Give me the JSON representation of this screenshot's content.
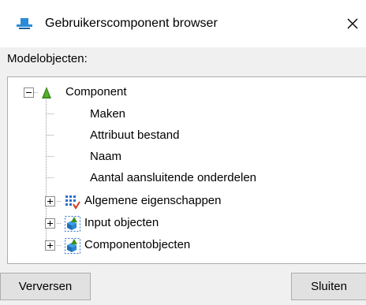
{
  "window": {
    "title": "Gebruikerscomponent browser",
    "app_icon": "tekla-logo-icon",
    "close_icon": "close-icon"
  },
  "tree_section": {
    "label": "Modelobjecten:",
    "root": {
      "label": "Component",
      "icon": "triangle-component-icon",
      "expanded": true,
      "children": [
        {
          "label": "Maken"
        },
        {
          "label": "Attribuut bestand"
        },
        {
          "label": "Naam"
        },
        {
          "label": "Aantal aansluitende onderdelen"
        },
        {
          "label": "Algemene eigenschappen",
          "icon": "properties-icon",
          "expandable": true
        },
        {
          "label": "Input objecten",
          "icon": "objects-icon",
          "expandable": true
        },
        {
          "label": "Componentobjecten",
          "icon": "objects-icon",
          "expandable": true
        }
      ]
    }
  },
  "buttons": {
    "refresh": "Verversen",
    "close": "Sluiten"
  },
  "colors": {
    "accent": "#2a8ad8",
    "component_icon": "#3e8e1e"
  }
}
